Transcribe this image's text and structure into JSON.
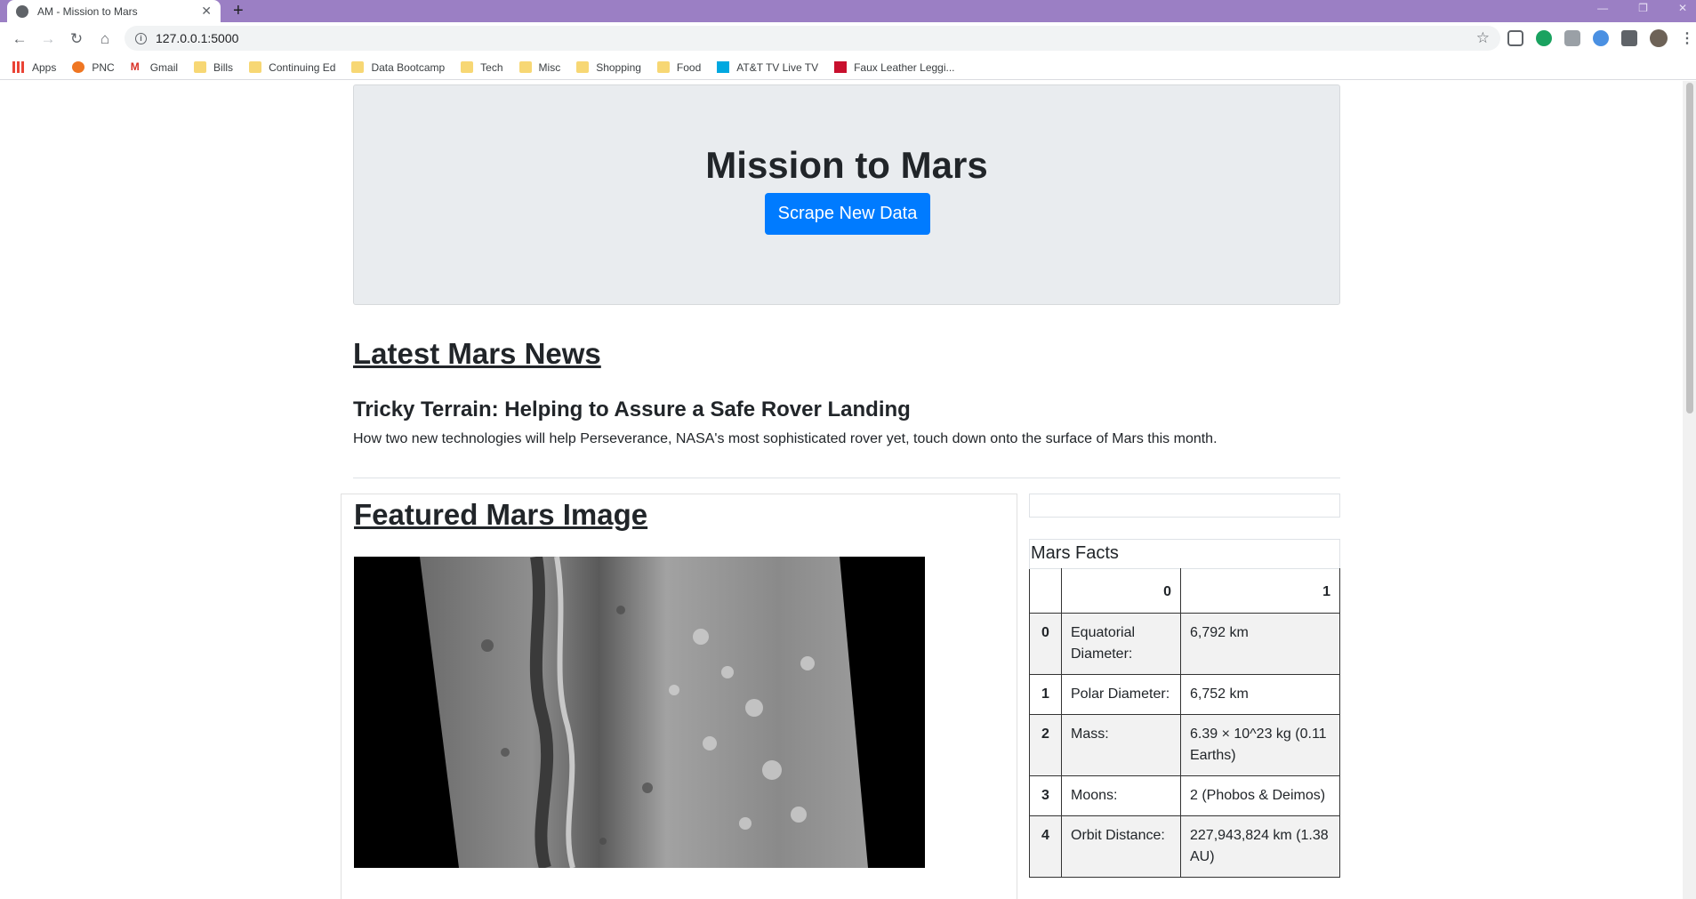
{
  "browser": {
    "tab_title": "AM - Mission to Mars",
    "url": "127.0.0.1:5000",
    "bookmarks": [
      {
        "label": "Apps",
        "icon": "apps-grid-icon",
        "color": "#ea4335"
      },
      {
        "label": "PNC",
        "icon": "pnc-icon",
        "color": "#ef7622"
      },
      {
        "label": "Gmail",
        "icon": "gmail-icon",
        "color": "#d93025"
      },
      {
        "label": "Bills",
        "icon": "folder-icon",
        "color": "#f7d774"
      },
      {
        "label": "Continuing Ed",
        "icon": "folder-icon",
        "color": "#f7d774"
      },
      {
        "label": "Data Bootcamp",
        "icon": "folder-icon",
        "color": "#f7d774"
      },
      {
        "label": "Tech",
        "icon": "folder-icon",
        "color": "#f7d774"
      },
      {
        "label": "Misc",
        "icon": "folder-icon",
        "color": "#f7d774"
      },
      {
        "label": "Shopping",
        "icon": "folder-icon",
        "color": "#f7d774"
      },
      {
        "label": "Food",
        "icon": "folder-icon",
        "color": "#f7d774"
      },
      {
        "label": "AT&T TV Live TV",
        "icon": "att-tv-icon",
        "color": "#00a8e0"
      },
      {
        "label": "Faux Leather Leggi...",
        "icon": "bookmark-red-icon",
        "color": "#c8102e"
      }
    ]
  },
  "page": {
    "title": "Mission to Mars",
    "scrape_button": "Scrape New Data",
    "news_heading": "Latest Mars News",
    "news_title": "Tricky Terrain: Helping to Assure a Safe Rover Landing",
    "news_paragraph": "How two new technologies will help Perseverance, NASA's most sophisticated rover yet, touch down onto the surface of Mars this month.",
    "featured_heading": "Featured Mars Image",
    "facts_caption": "Mars Facts",
    "facts_table": {
      "headers": [
        "",
        "0",
        "1"
      ],
      "rows": [
        {
          "index": "0",
          "label": "Equatorial Diameter:",
          "value": "6,792 km"
        },
        {
          "index": "1",
          "label": "Polar Diameter:",
          "value": "6,752 km"
        },
        {
          "index": "2",
          "label": "Mass:",
          "value": "6.39 × 10^23 kg (0.11 Earths)"
        },
        {
          "index": "3",
          "label": "Moons:",
          "value": "2 (Phobos & Deimos)"
        },
        {
          "index": "4",
          "label": "Orbit Distance:",
          "value": "227,943,824 km (1.38 AU)"
        }
      ]
    }
  },
  "colors": {
    "tabstrip": "#9b7fc4",
    "primary_button": "#007bff",
    "jumbotron": "#e9ecef"
  }
}
